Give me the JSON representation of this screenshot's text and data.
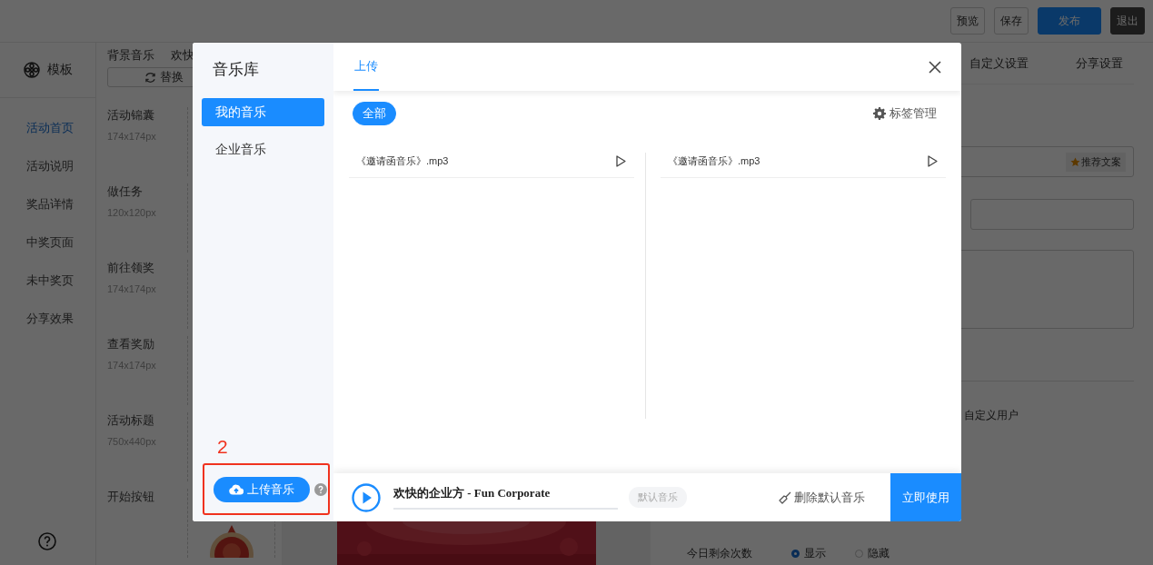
{
  "topbar": {
    "buttons": [
      {
        "label": "预览",
        "kind": "outline"
      },
      {
        "label": "保存",
        "kind": "outline"
      },
      {
        "label": "发布",
        "kind": "primary"
      },
      {
        "label": "退出",
        "kind": "dark"
      }
    ]
  },
  "nav": {
    "header": "模板",
    "items": [
      {
        "label": "活动首页",
        "selected": true
      },
      {
        "label": "活动说明",
        "selected": false
      },
      {
        "label": "奖品详情",
        "selected": false
      },
      {
        "label": "中奖页面",
        "selected": false
      },
      {
        "label": "未中奖页",
        "selected": false
      },
      {
        "label": "分享效果",
        "selected": false
      }
    ]
  },
  "assets": {
    "tabs": [
      "背景音乐",
      "欢快"
    ],
    "replace_button": "替换",
    "items": [
      {
        "title": "活动锦囊",
        "size": "174x174px"
      },
      {
        "title": "做任务",
        "size": "120x120px"
      },
      {
        "title": "前往领奖",
        "size": "174x174px"
      },
      {
        "title": "查看奖励",
        "size": "174x174px"
      },
      {
        "title": "活动标题",
        "size": "750x440px"
      },
      {
        "title": "开始按钮"
      }
    ]
  },
  "settings": {
    "tabs": [
      "自定义设置",
      "分享设置"
    ],
    "recommend_button": "推荐文案",
    "custom_user_label": "自定义用户",
    "remaining_row": {
      "label": "今日剩余次数",
      "options": [
        {
          "label": "显示",
          "selected": true
        },
        {
          "label": "隐藏",
          "selected": false
        }
      ]
    }
  },
  "modal": {
    "title": "音乐库",
    "categories": [
      {
        "label": "我的音乐",
        "selected": true
      },
      {
        "label": "企业音乐",
        "selected": false
      }
    ],
    "annotation": "2",
    "upload_button": "上传音乐",
    "tabs": [
      {
        "label": "上传",
        "selected": true
      }
    ],
    "filter_tags": [
      {
        "label": "全部",
        "selected": true
      }
    ],
    "tag_manage": "标签管理",
    "track_columns": [
      [
        {
          "name": "《邀请函音乐》.mp3"
        }
      ],
      [
        {
          "name": "《邀请函音乐》.mp3"
        }
      ]
    ],
    "player": {
      "title": "欢快的企业方 - Fun Corporate",
      "default_badge": "默认音乐",
      "delete_default": "删除默认音乐",
      "use_button": "立即使用"
    }
  }
}
